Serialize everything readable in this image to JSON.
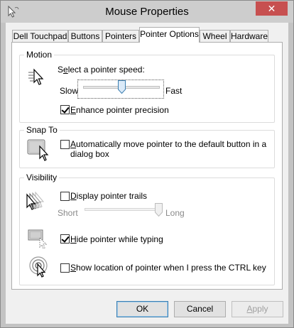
{
  "window": {
    "title": "Mouse Properties",
    "close_glyph": "✕"
  },
  "tabs": [
    {
      "label": "Dell Touchpad"
    },
    {
      "label": "Buttons"
    },
    {
      "label": "Pointers"
    },
    {
      "label": "Pointer Options",
      "active": true
    },
    {
      "label": "Wheel"
    },
    {
      "label": "Hardware"
    }
  ],
  "motion": {
    "group_label": "Motion",
    "speed_label_pre": "S",
    "speed_label_acc": "e",
    "speed_label_post": "lect a pointer speed:",
    "slow": "Slow",
    "fast": "Fast",
    "speed_level": 0.5,
    "precision_label_acc": "E",
    "precision_label": "nhance pointer precision",
    "precision_checked": true,
    "icon": "pointer-speed-icon"
  },
  "snap": {
    "group_label": "Snap To",
    "snap_label_acc": "A",
    "snap_label_line1": "utomatically move pointer to the default button in a",
    "snap_label_line2": "dialog box",
    "snap_checked": false,
    "icon": "snap-to-icon"
  },
  "visibility": {
    "group_label": "Visibility",
    "trails_label_acc": "D",
    "trails_label": "isplay pointer trails",
    "trails_checked": false,
    "short": "Short",
    "long": "Long",
    "trails_level": 1.0,
    "hide_label_acc": "H",
    "hide_label": "ide pointer while typing",
    "hide_checked": true,
    "ctrl_label_acc": "S",
    "ctrl_label": "how location of pointer when I press the CTRL key",
    "ctrl_checked": false,
    "icons": [
      "pointer-trails-icon",
      "hide-pointer-icon",
      "ctrl-locate-icon"
    ]
  },
  "buttons": {
    "ok": "OK",
    "cancel": "Cancel",
    "apply_acc": "A",
    "apply": "pply"
  }
}
